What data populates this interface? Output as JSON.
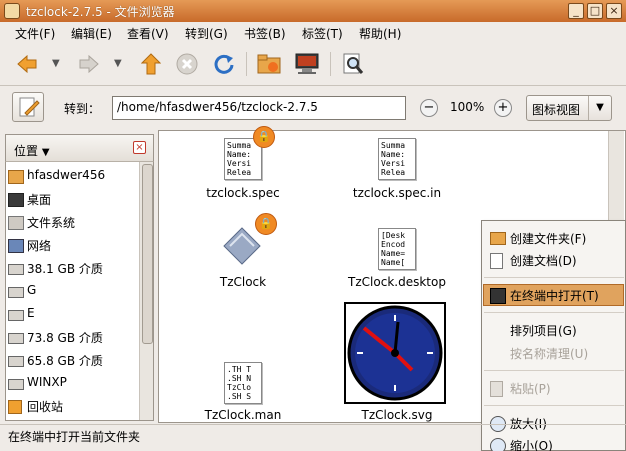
{
  "window": {
    "title": "tzclock-2.7.5 - 文件浏览器",
    "controls": [
      "_",
      "□",
      "×"
    ]
  },
  "menubar": [
    "文件(F)",
    "编辑(E)",
    "查看(V)",
    "转到(G)",
    "书签(B)",
    "标签(T)",
    "帮助(H)"
  ],
  "toolbar": {
    "buttons": [
      "back-arrow",
      "forward-arrow",
      "up-arrow",
      "stop",
      "reload",
      "home-folder",
      "computer",
      "search"
    ]
  },
  "location": {
    "goto_label": "转到：",
    "path": "/home/hfasdwer456/tzclock-2.7.5",
    "zoom": "100%",
    "view_mode": "图标视图"
  },
  "sidebar": {
    "title": "位置",
    "items": [
      {
        "label": "hfasdwer456",
        "icon": "home-folder-icon"
      },
      {
        "label": "桌面",
        "icon": "desktop-icon"
      },
      {
        "label": "文件系统",
        "icon": "filesystem-icon"
      },
      {
        "label": "网络",
        "icon": "network-icon"
      },
      {
        "label": "38.1 GB 介质",
        "icon": "drive-icon"
      },
      {
        "label": "G",
        "icon": "drive-icon"
      },
      {
        "label": "E",
        "icon": "drive-icon"
      },
      {
        "label": "73.8 GB 介质",
        "icon": "drive-icon"
      },
      {
        "label": "65.8 GB 介质",
        "icon": "drive-icon"
      },
      {
        "label": "WINXP",
        "icon": "drive-icon"
      },
      {
        "label": "回收站",
        "icon": "trash-icon"
      }
    ]
  },
  "files": [
    {
      "name": "tzclock.spec",
      "preview": [
        "Summa",
        "Name:",
        "Versi",
        "Relea"
      ]
    },
    {
      "name": "tzclock.spec.in",
      "preview": [
        "Summa",
        "Name:",
        "Versi",
        "Relea"
      ]
    },
    {
      "name": "TzClock"
    },
    {
      "name": "TzClock.desktop",
      "preview": [
        "[Desk",
        "Encod",
        "Name=",
        "Name["
      ]
    },
    {
      "name": "TzClock.man",
      "preview": [
        ".TH T",
        ".SH N",
        "TzClo",
        ".SH S"
      ]
    },
    {
      "name": "TzClock.svg"
    }
  ],
  "context_menu": {
    "items": [
      {
        "label": "创建文件夹(F)",
        "enabled": true
      },
      {
        "label": "创建文档(D)",
        "enabled": true
      },
      {
        "label": "在终端中打开(T)",
        "enabled": true,
        "highlighted": true
      },
      {
        "label": "排列项目(G)",
        "enabled": true
      },
      {
        "label": "按名称清理(U)",
        "enabled": false
      },
      {
        "label": "粘贴(P)",
        "enabled": false
      },
      {
        "label": "放大(I)",
        "enabled": true
      },
      {
        "label": "缩小(O)",
        "enabled": true
      }
    ]
  },
  "statusbar": {
    "text": "在终端中打开当前文件夹"
  },
  "colors": {
    "titlebar": "#d47a36",
    "highlight": "#e0a35e",
    "accent_orange": "#f08a24"
  }
}
